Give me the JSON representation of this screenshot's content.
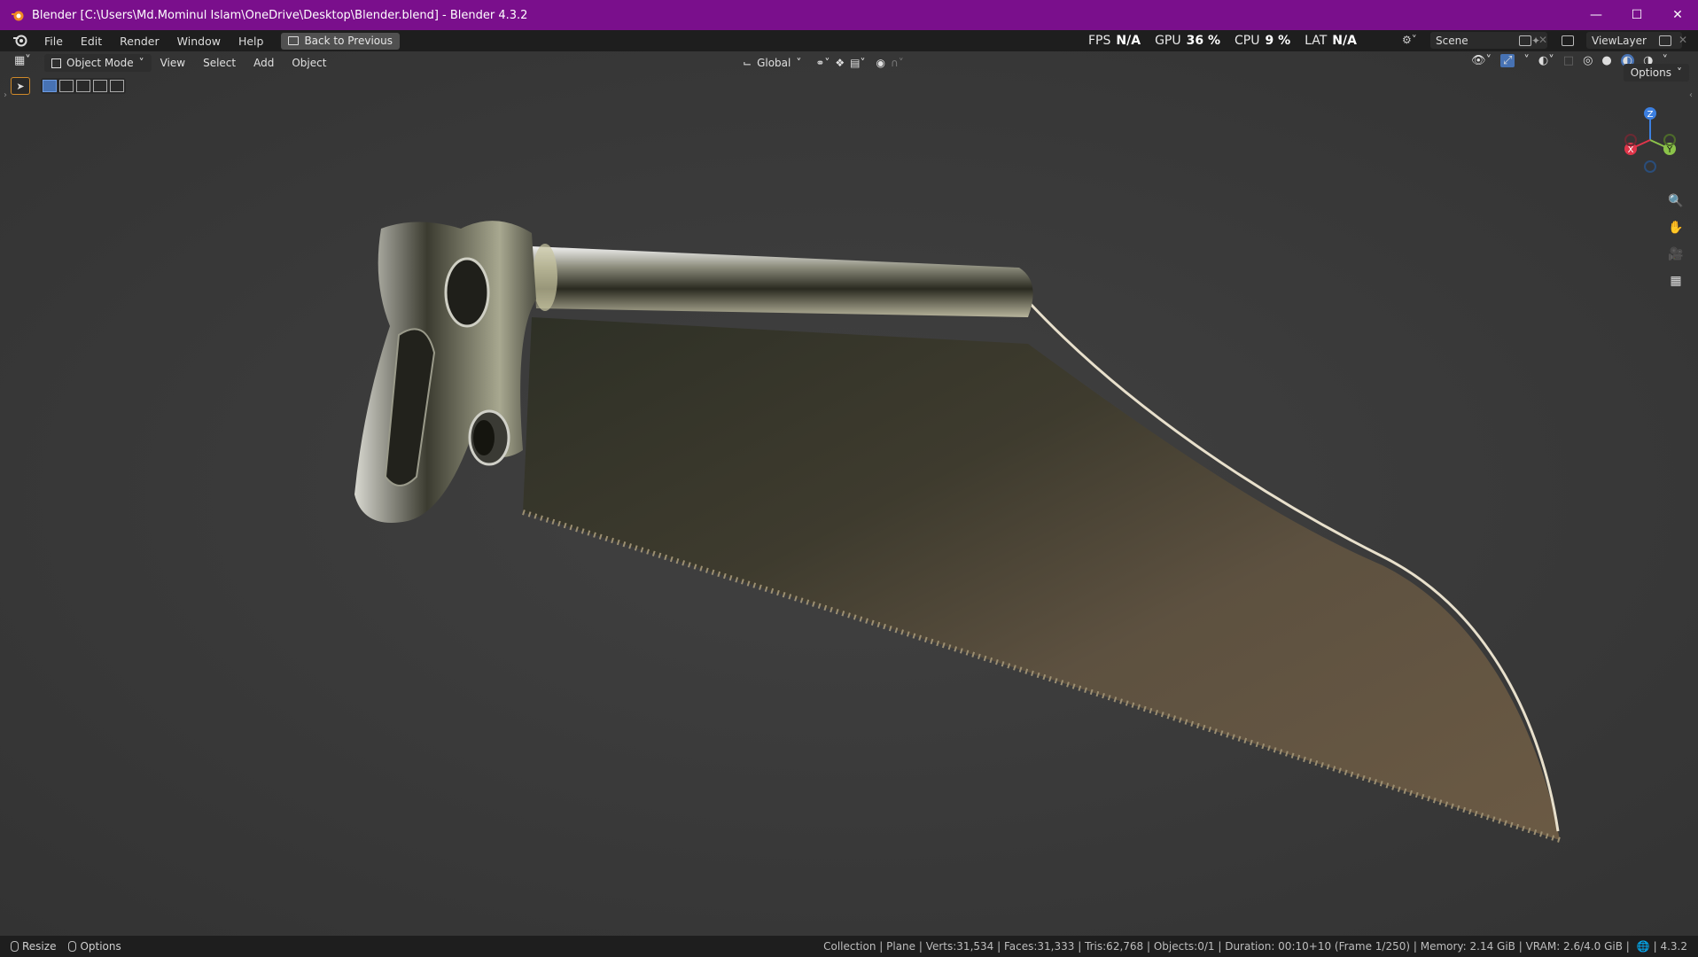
{
  "window": {
    "title": "Blender [C:\\Users\\Md.Mominul Islam\\OneDrive\\Desktop\\Blender.blend] - Blender 4.3.2",
    "minimize": "—",
    "maximize": "☐",
    "close": "✕"
  },
  "menubar": {
    "items": [
      "File",
      "Edit",
      "Render",
      "Window",
      "Help"
    ],
    "back_button": "Back to Previous"
  },
  "stats": {
    "fps_label": "FPS",
    "fps_value": "N/A",
    "gpu_label": "GPU",
    "gpu_value": "36 %",
    "cpu_label": "CPU",
    "cpu_value": "9 %",
    "lat_label": "LAT",
    "lat_value": "N/A"
  },
  "scene": {
    "name": "Scene"
  },
  "view_layer": {
    "name": "ViewLayer"
  },
  "viewport_header": {
    "mode": "Object Mode",
    "menus": [
      "View",
      "Select",
      "Add",
      "Object"
    ],
    "orientation": "Global",
    "options": "Options"
  },
  "gizmo": {
    "x": "X",
    "y": "Y",
    "z": "Z"
  },
  "statusbar": {
    "resize": "Resize",
    "options": "Options",
    "info": "Collection | Plane | Verts:31,534 | Faces:31,333 | Tris:62,768 | Objects:0/1 | Duration: 00:10+10 (Frame 1/250) | Memory: 2.14 GiB | VRAM: 2.6/4.0 GiB |",
    "version": "4.3.2"
  },
  "colors": {
    "titlebar": "#7a0f8c",
    "accent": "#4772b3",
    "viewport_bg": "#3b3b3b",
    "axis_x": "#e0354a",
    "axis_y": "#8bc34a",
    "axis_z": "#3c7fe0"
  }
}
